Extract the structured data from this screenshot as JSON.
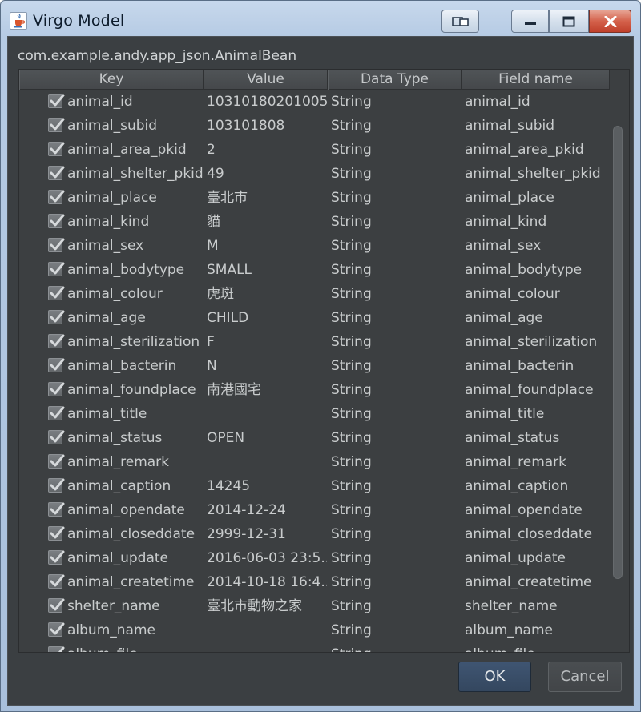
{
  "window": {
    "title": "Virgo Model",
    "icon": "java-cup-icon",
    "controls": [
      "switch-window-icon",
      "minimize-icon",
      "maximize-icon",
      "close-icon"
    ]
  },
  "class_name": "com.example.andy.app_json.AnimalBean",
  "table": {
    "columns": [
      "Key",
      "Value",
      "Data Type",
      "Field name"
    ],
    "rows": [
      {
        "checked": true,
        "key": "animal_id",
        "value": "10310180201005",
        "type": "String",
        "field": "animal_id"
      },
      {
        "checked": true,
        "key": "animal_subid",
        "value": "103101808",
        "type": "String",
        "field": "animal_subid"
      },
      {
        "checked": true,
        "key": "animal_area_pkid",
        "value": "2",
        "type": "String",
        "field": "animal_area_pkid"
      },
      {
        "checked": true,
        "key": "animal_shelter_pkid",
        "value": "49",
        "type": "String",
        "field": "animal_shelter_pkid"
      },
      {
        "checked": true,
        "key": "animal_place",
        "value": "臺北市",
        "type": "String",
        "field": "animal_place"
      },
      {
        "checked": true,
        "key": "animal_kind",
        "value": "貓",
        "type": "String",
        "field": "animal_kind"
      },
      {
        "checked": true,
        "key": "animal_sex",
        "value": "M",
        "type": "String",
        "field": "animal_sex"
      },
      {
        "checked": true,
        "key": "animal_bodytype",
        "value": "SMALL",
        "type": "String",
        "field": "animal_bodytype"
      },
      {
        "checked": true,
        "key": "animal_colour",
        "value": "虎斑",
        "type": "String",
        "field": "animal_colour"
      },
      {
        "checked": true,
        "key": "animal_age",
        "value": "CHILD",
        "type": "String",
        "field": "animal_age"
      },
      {
        "checked": true,
        "key": "animal_sterilization",
        "value": "F",
        "type": "String",
        "field": "animal_sterilization"
      },
      {
        "checked": true,
        "key": "animal_bacterin",
        "value": "N",
        "type": "String",
        "field": "animal_bacterin"
      },
      {
        "checked": true,
        "key": "animal_foundplace",
        "value": "南港國宅",
        "type": "String",
        "field": "animal_foundplace"
      },
      {
        "checked": true,
        "key": "animal_title",
        "value": "",
        "type": "String",
        "field": "animal_title"
      },
      {
        "checked": true,
        "key": "animal_status",
        "value": "OPEN",
        "type": "String",
        "field": "animal_status"
      },
      {
        "checked": true,
        "key": "animal_remark",
        "value": "",
        "type": "String",
        "field": "animal_remark"
      },
      {
        "checked": true,
        "key": "animal_caption",
        "value": "14245",
        "type": "String",
        "field": "animal_caption"
      },
      {
        "checked": true,
        "key": "animal_opendate",
        "value": "2014-12-24",
        "type": "String",
        "field": "animal_opendate"
      },
      {
        "checked": true,
        "key": "animal_closeddate",
        "value": "2999-12-31",
        "type": "String",
        "field": "animal_closeddate"
      },
      {
        "checked": true,
        "key": "animal_update",
        "value": "2016-06-03 23:5...",
        "type": "String",
        "field": "animal_update"
      },
      {
        "checked": true,
        "key": "animal_createtime",
        "value": "2014-10-18 16:4...",
        "type": "String",
        "field": "animal_createtime"
      },
      {
        "checked": true,
        "key": "shelter_name",
        "value": "臺北市動物之家",
        "type": "String",
        "field": "shelter_name"
      },
      {
        "checked": true,
        "key": "album_name",
        "value": "",
        "type": "String",
        "field": "album_name"
      },
      {
        "checked": true,
        "key": "album_file",
        "value": "",
        "type": "String",
        "field": "album_file"
      }
    ]
  },
  "buttons": {
    "ok_label": "OK",
    "cancel_label": "Cancel"
  }
}
